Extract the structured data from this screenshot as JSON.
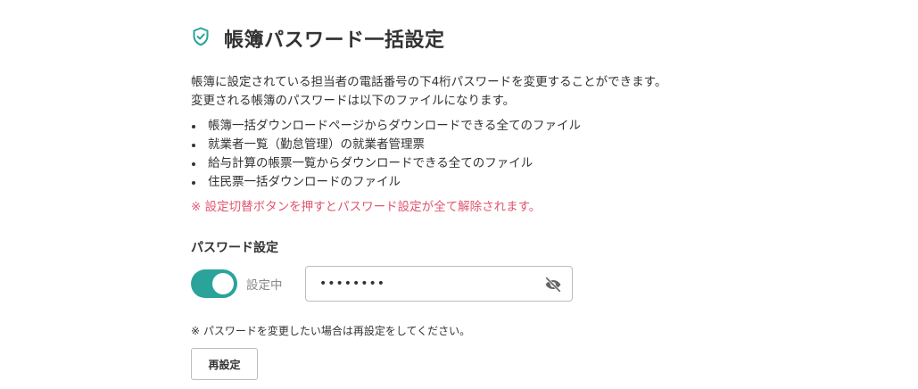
{
  "header": {
    "icon": "shield-check-icon",
    "title": "帳簿パスワード一括設定"
  },
  "description": {
    "line1": "帳簿に設定されている担当者の電話番号の下4桁パスワードを変更することができます。",
    "line2": "変更される帳簿のパスワードは以下のファイルになります。"
  },
  "files": [
    "帳簿一括ダウンロードページからダウンロードできる全てのファイル",
    "就業者一覧（勤怠管理）の就業者管理票",
    "給与計算の帳票一覧からダウンロードできる全てのファイル",
    "住民票一括ダウンロードのファイル"
  ],
  "warning": "※ 設定切替ボタンを押すとパスワード設定が全て解除されます。",
  "password_setting": {
    "label": "パスワード設定",
    "toggle_on": true,
    "toggle_label": "設定中",
    "value": "••••••••",
    "visibility_icon": "eye-off-icon"
  },
  "note": "※ パスワードを変更したい場合は再設定をしてください。",
  "reset_button": "再設定",
  "colors": {
    "accent": "#2aa39a",
    "warning": "#e0566e"
  }
}
